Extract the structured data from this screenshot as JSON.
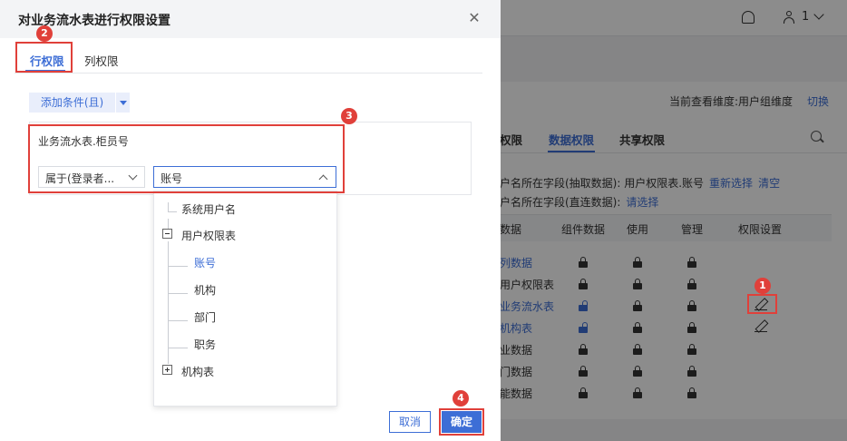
{
  "background": {
    "user_count": "1",
    "view_label": "当前查看维度:用户组维度",
    "switch_link": "切换",
    "tabs": [
      {
        "label": "权限"
      },
      {
        "label": "数据权限"
      },
      {
        "label": "共享权限"
      }
    ],
    "field_lines": [
      {
        "text": "户名所在字段(抽取数据): 用户权限表.账号",
        "links": [
          "重新选择",
          "清空"
        ]
      },
      {
        "text": "户名所在字段(直连数据):",
        "links": [
          "请选择"
        ]
      }
    ],
    "table_headers": [
      "数据",
      "组件数据",
      "使用",
      "管理",
      "权限设置"
    ],
    "rows": [
      {
        "name": "列数据",
        "blue": true
      },
      {
        "name": "用户权限表",
        "blue": false
      },
      {
        "name": "业务流水表",
        "blue": true
      },
      {
        "name": "机构表",
        "blue": true
      },
      {
        "name": "业数据",
        "blue": false
      },
      {
        "name": "门数据",
        "blue": false
      },
      {
        "name": "能数据",
        "blue": false
      }
    ]
  },
  "dialog": {
    "title": "对业务流水表进行权限设置",
    "close_icon": "close-icon",
    "tabs": [
      {
        "label": "行权限",
        "active": true
      },
      {
        "label": "列权限",
        "active": false
      }
    ],
    "add_condition_label": "添加条件(且)",
    "condition": {
      "field_label": "业务流水表.柜员号",
      "operator_value": "属于(登录者...",
      "value_select": "账号"
    },
    "tree": {
      "items": [
        {
          "label": "系统用户名"
        },
        {
          "label": "用户权限表",
          "expander": "minus"
        },
        {
          "label": "账号",
          "selected": true
        },
        {
          "label": "机构"
        },
        {
          "label": "部门"
        },
        {
          "label": "职务"
        },
        {
          "label": "机构表",
          "expander": "plus"
        }
      ]
    },
    "cancel_label": "取消",
    "ok_label": "确定"
  },
  "annotations": {
    "badges": [
      "1",
      "2",
      "3",
      "4"
    ],
    "highlight_color": "#e0403a"
  },
  "colors": {
    "accent": "#3d6ed6",
    "highlight": "#e0403a"
  }
}
